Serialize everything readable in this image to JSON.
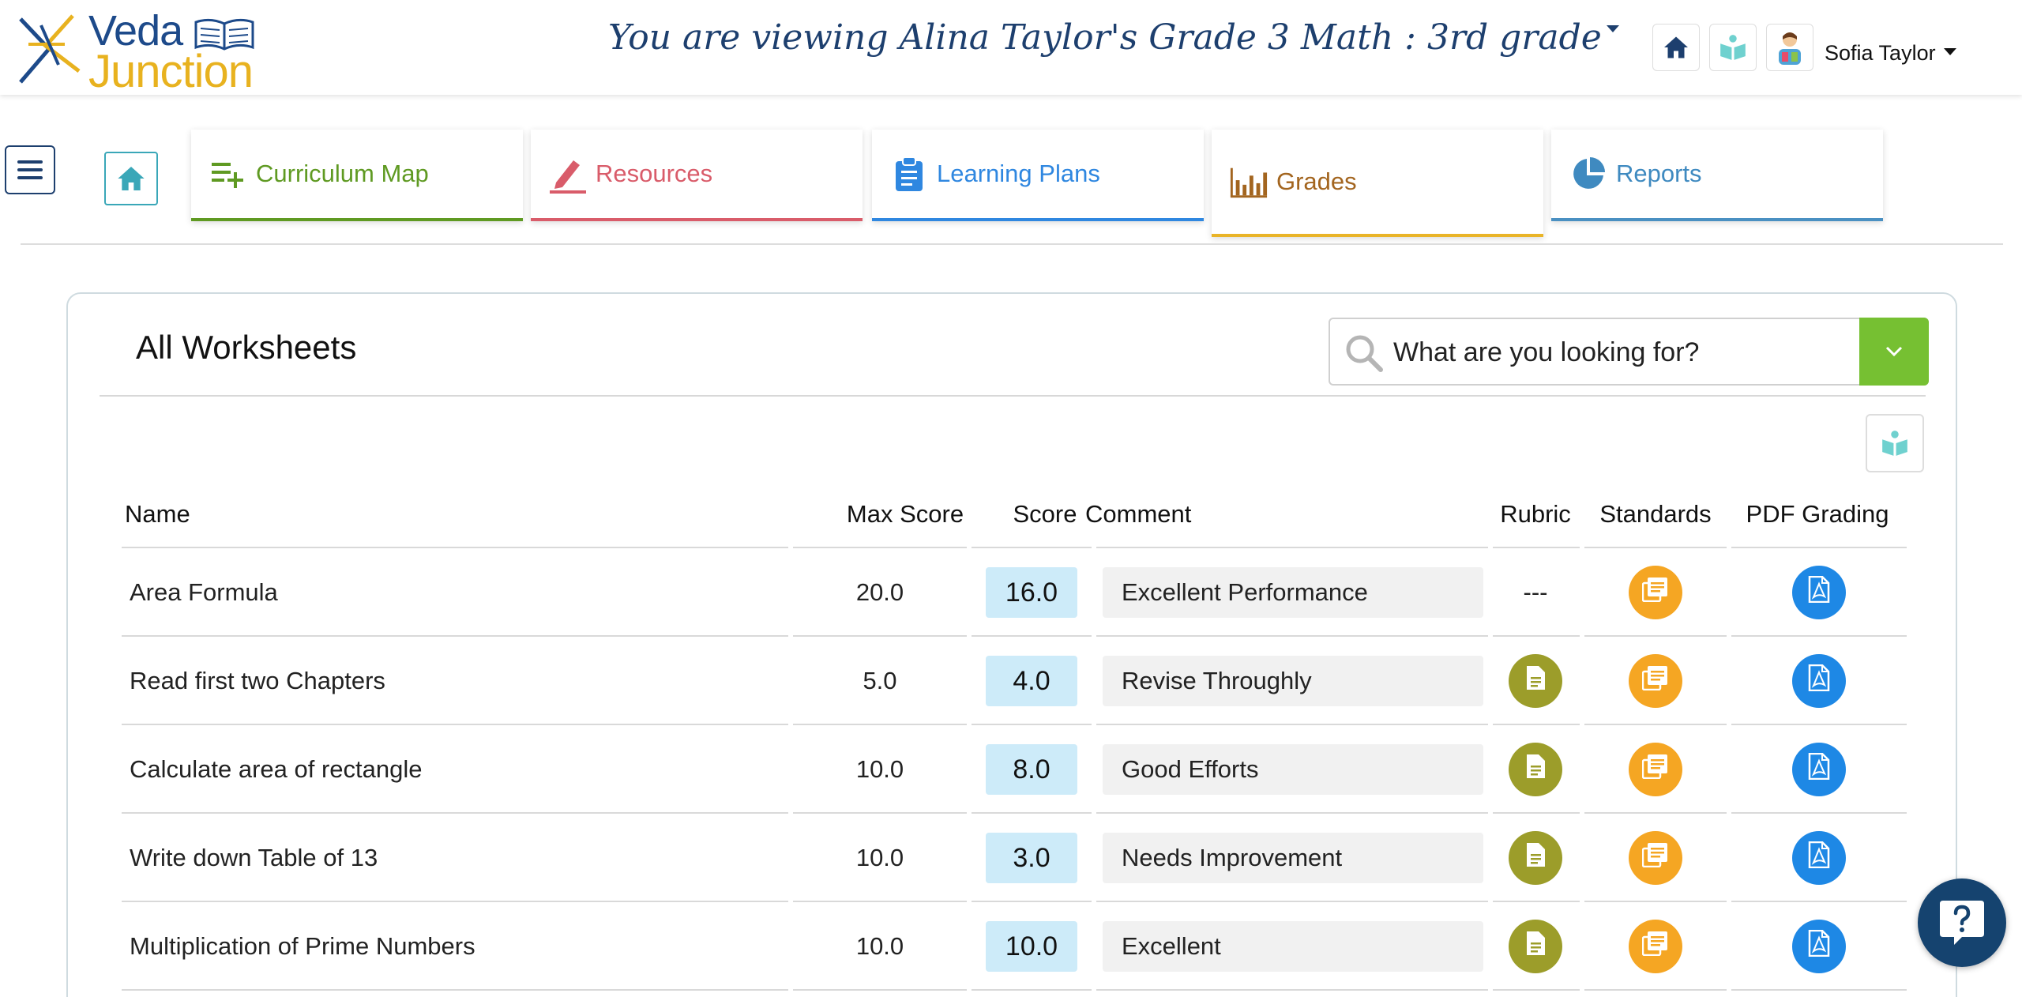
{
  "header": {
    "logo_line1": "Veda",
    "logo_line2": "Junction",
    "viewing_text": "You are viewing Alina Taylor's Grade 3 Math : 3rd grade",
    "user_name": "Sofia Taylor"
  },
  "nav": {
    "tabs": [
      {
        "label": "Curriculum Map",
        "icon": "playlist-add-icon",
        "color": "#5f9a22"
      },
      {
        "label": "Resources",
        "icon": "pencil-icon",
        "color": "#d95c6a"
      },
      {
        "label": "Learning Plans",
        "icon": "clipboard-icon",
        "color": "#2f87e0"
      },
      {
        "label": "Grades",
        "icon": "bar-chart-icon",
        "color": "#a3651f"
      },
      {
        "label": "Reports",
        "icon": "pie-chart-icon",
        "color": "#3f8ac0"
      }
    ]
  },
  "main": {
    "title": "All Worksheets",
    "search_placeholder": "What are you looking for?",
    "columns": {
      "name": "Name",
      "max_score": "Max Score",
      "score": "Score",
      "comment": "Comment",
      "rubric": "Rubric",
      "standards": "Standards",
      "pdf_grading": "PDF Grading"
    },
    "rows": [
      {
        "name": "Area Formula",
        "max_score": "20.0",
        "score": "16.0",
        "comment": "Excellent Performance",
        "rubric": "---"
      },
      {
        "name": "Read first two Chapters",
        "max_score": "5.0",
        "score": "4.0",
        "comment": "Revise Throughly",
        "rubric": ""
      },
      {
        "name": "Calculate area of rectangle",
        "max_score": "10.0",
        "score": "8.0",
        "comment": "Good Efforts",
        "rubric": ""
      },
      {
        "name": "Write down Table of 13",
        "max_score": "10.0",
        "score": "3.0",
        "comment": "Needs Improvement",
        "rubric": ""
      },
      {
        "name": "Multiplication of Prime Numbers",
        "max_score": "10.0",
        "score": "10.0",
        "comment": "Excellent",
        "rubric": ""
      }
    ]
  },
  "colors": {
    "brand_blue": "#1d4a8a",
    "brand_yellow": "#e8b21f",
    "search_green": "#76c032",
    "score_bg": "#cdebf9",
    "rubric_olive": "#9c9d2a",
    "standards_orange": "#f5a623",
    "pdf_blue": "#1e88e5",
    "help_navy": "#15436f"
  }
}
